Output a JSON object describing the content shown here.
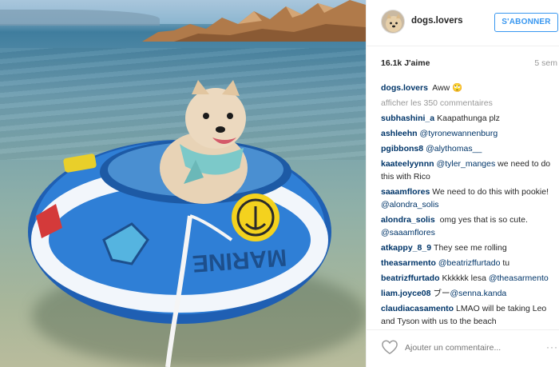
{
  "photo": {
    "raft_text": "MARINE"
  },
  "header": {
    "username": "dogs.lovers",
    "follow_label": "S'ABONNER"
  },
  "stats": {
    "likes": "16.1k J'aime",
    "time": "5 sem"
  },
  "caption": {
    "user": "dogs.lovers",
    "text": "Aww 🙄"
  },
  "load_more": "afficher les 350 commentaires",
  "comments": [
    {
      "user": "subhashini_a",
      "text": "Kaapathunga plz",
      "mention": ""
    },
    {
      "user": "ashleehn",
      "text": "",
      "mention": "@tyronewannenburg"
    },
    {
      "user": "pgibbons8",
      "text": "",
      "mention": "@alythomas__"
    },
    {
      "user": "kaateelyynnn",
      "mention": "@tyler_manges",
      "text": "we need to do this with Rico"
    },
    {
      "user": "saaamflores",
      "text": "We need to do this with pookie!",
      "mention": "@alondra_solis"
    },
    {
      "user": "alondra_solis",
      "text": "­­­ omg yes that is so cute.",
      "mention": "@saaamflores"
    },
    {
      "user": "atkappy_8_9",
      "text": "They see me rolling",
      "mention": ""
    },
    {
      "user": "theasarmento",
      "mention": "@beatrizffurtado",
      "text": "tu"
    },
    {
      "user": "beatrizffurtado",
      "text": "Kkkkkk lesa­",
      "mention": "@theasarmento"
    },
    {
      "user": "liam.joyce08",
      "text": "ブー",
      "mention": "@senna.kanda"
    },
    {
      "user": "claudiacasamento",
      "text": "LMAO will be taking Leo and Tyson with us to the beach",
      "mention": ""
    }
  ],
  "footer": {
    "add_comment_placeholder": "Ajouter un commentaire...",
    "more_label": "···"
  },
  "icons": {
    "heart": "heart-icon",
    "avatar": "dog-avatar",
    "more": "more-options-icon"
  },
  "colors": {
    "accent": "#3897f0",
    "link": "#003569",
    "muted": "#999999"
  }
}
